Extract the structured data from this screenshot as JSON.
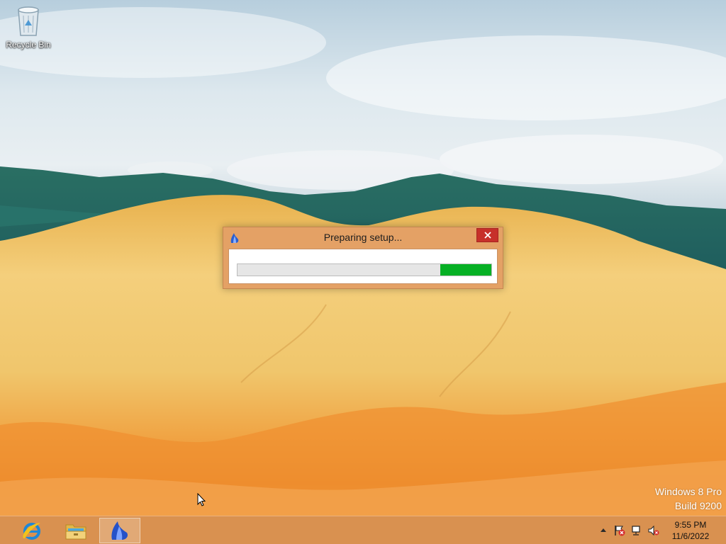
{
  "desktop": {
    "icons": [
      {
        "label": "Recycle Bin",
        "icon": "recycle-bin-icon"
      }
    ],
    "watermark": {
      "line1": "Windows 8 Pro",
      "line2": "Build 9200"
    }
  },
  "dialog": {
    "title": "Preparing setup...",
    "app_icon": "setup-app-icon",
    "close_icon": "close-icon",
    "progress": 0.2,
    "accent_color": "#e4a165",
    "progress_color": "#06b025"
  },
  "taskbar": {
    "color": "#d99150",
    "pinned": [
      {
        "name": "internet-explorer",
        "icon": "internet-explorer-icon",
        "active": false
      },
      {
        "name": "file-explorer",
        "icon": "folder-icon",
        "active": false
      },
      {
        "name": "setup",
        "icon": "setup-app-icon",
        "active": true
      }
    ],
    "tray": {
      "icons": [
        "show-hidden-icons-icon",
        "action-center-icon",
        "network-icon",
        "volume-muted-icon"
      ],
      "time": "9:55 PM",
      "date": "11/6/2022"
    }
  }
}
